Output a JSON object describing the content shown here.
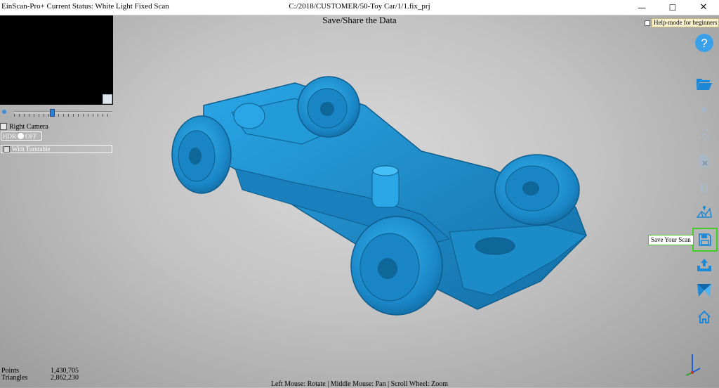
{
  "titlebar": {
    "app_title": "EinScan-Pro+ Current Status: White Light Fixed Scan",
    "file_path": "C:/2018/CUSTOMER/50-Toy Car/1/1.fix_prj",
    "minimize": "—",
    "maximize": "☐",
    "close": "✕"
  },
  "view": {
    "title": "Save/Share the Data"
  },
  "left_panel": {
    "right_camera_label": "Right Camera",
    "hdr_label": "HDR",
    "hdr_state": "OFF",
    "turntable_label": "With Turntable"
  },
  "help_mode": {
    "label": "Help-mode for beginners"
  },
  "toolbar": {
    "items": [
      {
        "name": "help",
        "icon": "question-circle-icon"
      },
      {
        "name": "open",
        "icon": "folder-open-icon"
      },
      {
        "name": "play",
        "icon": "play-icon"
      },
      {
        "name": "point-cloud",
        "icon": "scatter-points-icon"
      },
      {
        "name": "delete",
        "icon": "delete-document-icon"
      },
      {
        "name": "pause",
        "icon": "pause-icon"
      },
      {
        "name": "mesh",
        "icon": "mesh-icon"
      },
      {
        "name": "save",
        "icon": "floppy-disk-icon",
        "tooltip": "Save Your Scan"
      },
      {
        "name": "export",
        "icon": "upload-tray-icon"
      },
      {
        "name": "measure",
        "icon": "triangles-icon"
      },
      {
        "name": "home",
        "icon": "home-icon"
      }
    ]
  },
  "stats": {
    "points_label": "Points",
    "points_value": "1,430,705",
    "triangles_label": "Triangles",
    "triangles_value": "2,862,230"
  },
  "hint": {
    "text": "Left Mouse: Rotate | Middle Mouse: Pan | Scroll Wheel: Zoom"
  },
  "colors": {
    "model": "#1f8fcf",
    "highlight": "#44cc22",
    "icon": "#1e88d6"
  }
}
